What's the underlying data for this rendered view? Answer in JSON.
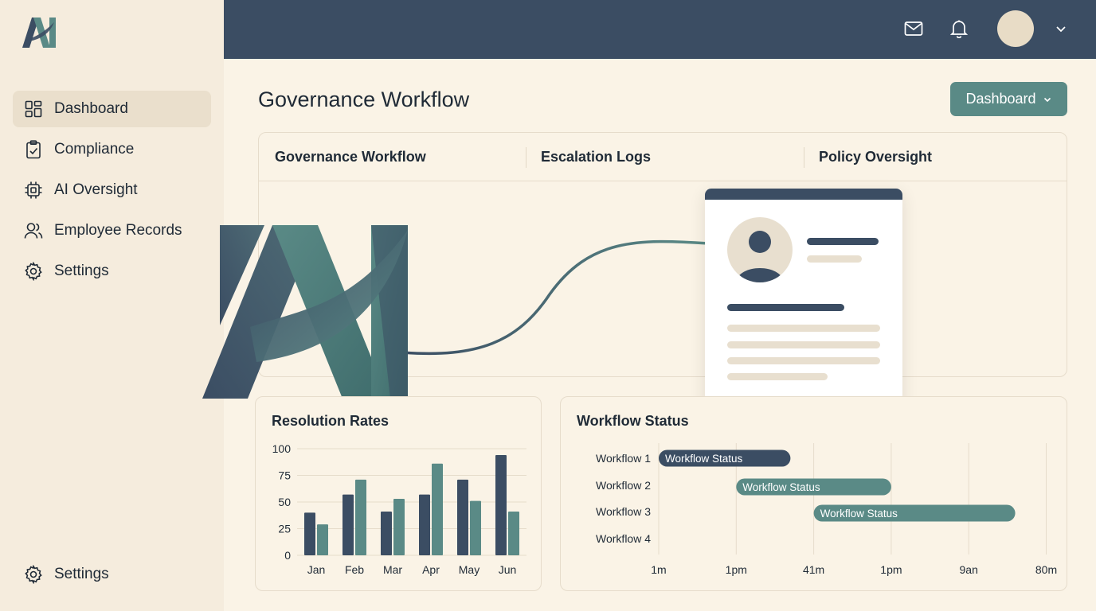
{
  "app": {
    "logo_text": "AI"
  },
  "sidebar": {
    "items": [
      {
        "label": "Dashboard",
        "icon": "dashboard-icon",
        "active": true
      },
      {
        "label": "Compliance",
        "icon": "clipboard-check-icon",
        "active": false
      },
      {
        "label": "AI Oversight",
        "icon": "chip-icon",
        "active": false
      },
      {
        "label": "Employee Records",
        "icon": "users-icon",
        "active": false
      },
      {
        "label": "Settings",
        "icon": "gear-icon",
        "active": false
      }
    ],
    "bottom": {
      "label": "Settings",
      "icon": "gear-icon"
    }
  },
  "topbar": {
    "icons": [
      "mail-icon",
      "bell-icon",
      "avatar",
      "chevron-down-icon"
    ]
  },
  "header": {
    "title": "Governance Workflow",
    "dropdown_label": "Dashboard"
  },
  "tabs": [
    {
      "label": "Governance Workflow"
    },
    {
      "label": "Escalation Logs"
    },
    {
      "label": "Policy Oversight"
    }
  ],
  "colors": {
    "navy": "#3b4d63",
    "teal": "#5a8a86",
    "background": "#faf3e6",
    "sidebar": "#f5ecdd"
  },
  "resolution_rates": {
    "title": "Resolution Rates",
    "chart_data": {
      "type": "bar",
      "categories": [
        "Jan",
        "Feb",
        "Mar",
        "Apr",
        "May",
        "Jun"
      ],
      "series": [
        {
          "values": [
            40,
            57,
            41,
            57,
            71,
            94
          ],
          "color": "#3b4d63"
        },
        {
          "values": [
            29,
            71,
            53,
            86,
            51,
            41
          ],
          "color": "#5a8a86"
        }
      ],
      "yticks": [
        "100",
        "75",
        "50",
        "25",
        "0"
      ],
      "ylim": [
        0,
        100
      ],
      "grid": true
    }
  },
  "workflow_status": {
    "title": "Workflow Status",
    "chart_data": {
      "type": "gantt",
      "rows": [
        "Workflow 1",
        "Workflow 2",
        "Workflow 3",
        "Workflow 4"
      ],
      "bars": [
        {
          "row": "Workflow 1",
          "label": "Workflow Status",
          "start": 0,
          "end": 1.7,
          "color": "#3b4d63"
        },
        {
          "row": "Workflow 2",
          "label": "Workflow Status",
          "start": 1.0,
          "end": 3.0,
          "color": "#5a8a86"
        },
        {
          "row": "Workflow 3",
          "label": "Workflow Status",
          "start": 2.0,
          "end": 4.6,
          "color": "#5a8a86"
        }
      ],
      "xticks": [
        "1m",
        "1pm",
        "41m",
        "1pm",
        "9an",
        "80m"
      ],
      "grid": true
    }
  }
}
